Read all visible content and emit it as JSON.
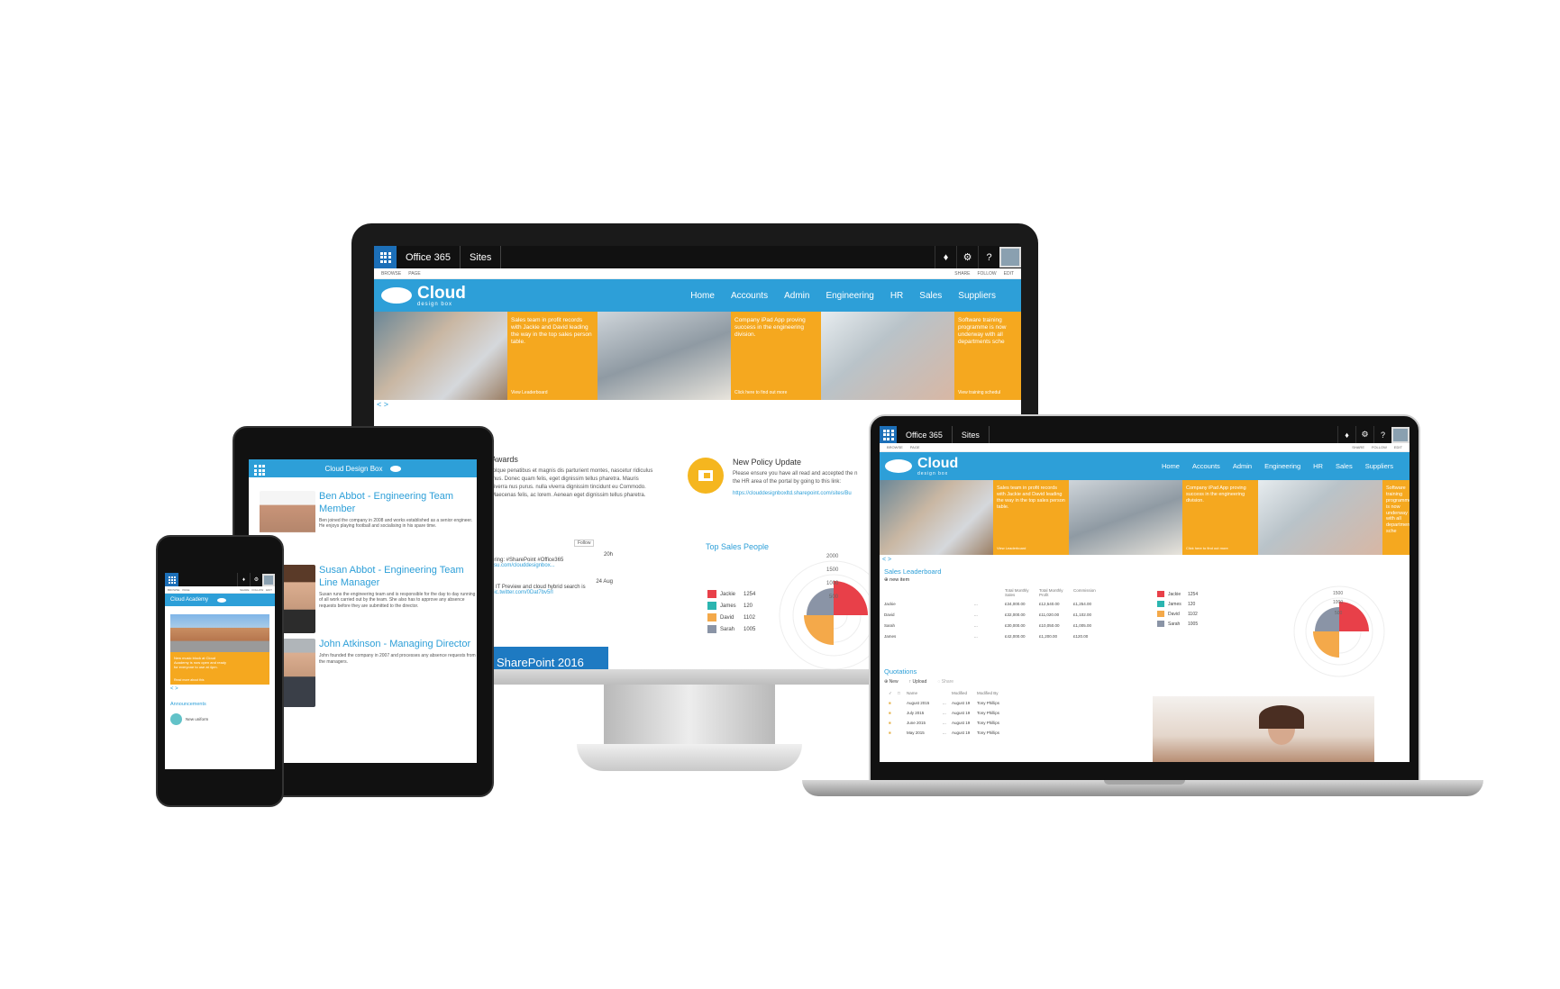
{
  "brand": {
    "suite_title": "Office 365",
    "sites": "Sites",
    "logo_main": "Cloud",
    "logo_sub": "design box",
    "site_name": "Cloud Design Box",
    "academy": "Cloud Academy"
  },
  "ribbon": {
    "browse": "BROWSE",
    "page": "PAGE",
    "share": "SHARE",
    "follow": "FOLLOW",
    "edit": "EDIT"
  },
  "nav": [
    "Home",
    "Accounts",
    "Admin",
    "Engineering",
    "HR",
    "Sales",
    "Suppliers"
  ],
  "banner": [
    {
      "text": "Sales team in profit records with Jackie and David leading the way in the top sales person table.",
      "link": "View Leaderboard"
    },
    {
      "text": "Company iPad App proving success in the engineering division.",
      "link": "Click here to find out more"
    },
    {
      "text": "Software training programme is now underway with all departments sche",
      "link": "View training schedul"
    }
  ],
  "desktop": {
    "awards_title": "Awards",
    "awards_text": "tolque penatibus et magnis dis parturient montes, nascetur ridiculus mus. Donec quam felis, eget dignissim tellus pharetra. Mauris viverra nus purus. nulla viverra dignissim tincidunt eu Commodo. Maecenas felis, ac lorem. Aenean eget dignissim tellus pharetra.",
    "policy_title": "New Policy Update",
    "policy_text": "Please ensure you have all read and accepted the n the HR area of the portal by going to this link:",
    "policy_link": "https://clouddesignboxltd.sharepoint.com/sites/Bu",
    "follow_btn": "Follow",
    "tweet1_a": "ering: #SharePoint #Office365",
    "tweet1_b": "ssu.com/clouddesignbox...",
    "tweet1_date": "20h",
    "tweet2_date": "24 Aug",
    "tweet2_a": "6 IT Preview and cloud hybrid search is",
    "tweet2_b": "pic.twitter.com/0Dat7bv5rl",
    "sp_banner": "SharePoint 2016",
    "top_sales_title": "Top Sales People"
  },
  "sales_people": [
    {
      "name": "Jackie",
      "value": "1254",
      "color": "#e84049"
    },
    {
      "name": "James",
      "value": "120",
      "color": "#2bb5b0"
    },
    {
      "name": "David",
      "value": "1102",
      "color": "#f4a94a"
    },
    {
      "name": "Sarah",
      "value": "1005",
      "color": "#8a94a6"
    }
  ],
  "radar_ticks": [
    "2000",
    "1500",
    "1000",
    "500"
  ],
  "radar_ticks_laptop": [
    "1500",
    "1000",
    "500"
  ],
  "laptop": {
    "leaderboard_title": "Sales Leaderboard",
    "new_item": "new item",
    "columns": [
      "Total Monthly Sales",
      "Total Monthly Profit",
      "Commission"
    ],
    "rows": [
      {
        "name": "Jackie",
        "sales": "£34,000.00",
        "profit": "£12,540.00",
        "comm": "£1,254.00"
      },
      {
        "name": "David",
        "sales": "£32,000.00",
        "profit": "£11,020.00",
        "comm": "£1,102.00"
      },
      {
        "name": "Sarah",
        "sales": "£30,000.00",
        "profit": "£10,050.00",
        "comm": "£1,005.00"
      },
      {
        "name": "James",
        "sales": "£42,000.00",
        "profit": "£1,200.00",
        "comm": "£120.00"
      }
    ],
    "quotations_title": "Quotations",
    "q_new": "New",
    "q_upload": "Upload",
    "q_share": "Share",
    "q_cols": [
      "Name",
      "Modified",
      "Modified By"
    ],
    "q_rows": [
      {
        "name": "August 2015",
        "mod": "August 19",
        "by": "Tony Phillips"
      },
      {
        "name": "July 2015",
        "mod": "August 19",
        "by": "Tony Phillips"
      },
      {
        "name": "June 2015",
        "mod": "August 19",
        "by": "Tony Phillips"
      },
      {
        "name": "May 2015",
        "mod": "August 19",
        "by": "Tony Phillips"
      }
    ]
  },
  "tablet": {
    "people": [
      {
        "title": "Ben Abbot - Engineering Team Member",
        "text": "Ben joined the company in 2008 and works established as a senior engineer. He enjoys playing football and socialising in his spare time."
      },
      {
        "title": "Susan Abbot - Engineering Team Line Manager",
        "text": "Susan runs the engineering team and is responsible for the day to day running of all work carried out by the team. She also has to approve any absence requests before they are submitted to the director."
      },
      {
        "title": "John Atkinson - Managing Director",
        "text": "John founded the company in 2007 and processes any absence requests from the managers."
      }
    ]
  },
  "phone": {
    "banner_text": "New music block at Cloud Academy is now open and ready for everyone to use at 4pm.",
    "banner_link": "Read more about this",
    "announcements": "Announcements",
    "new_uniform": "New uniform"
  },
  "nav_arrows": "< >"
}
